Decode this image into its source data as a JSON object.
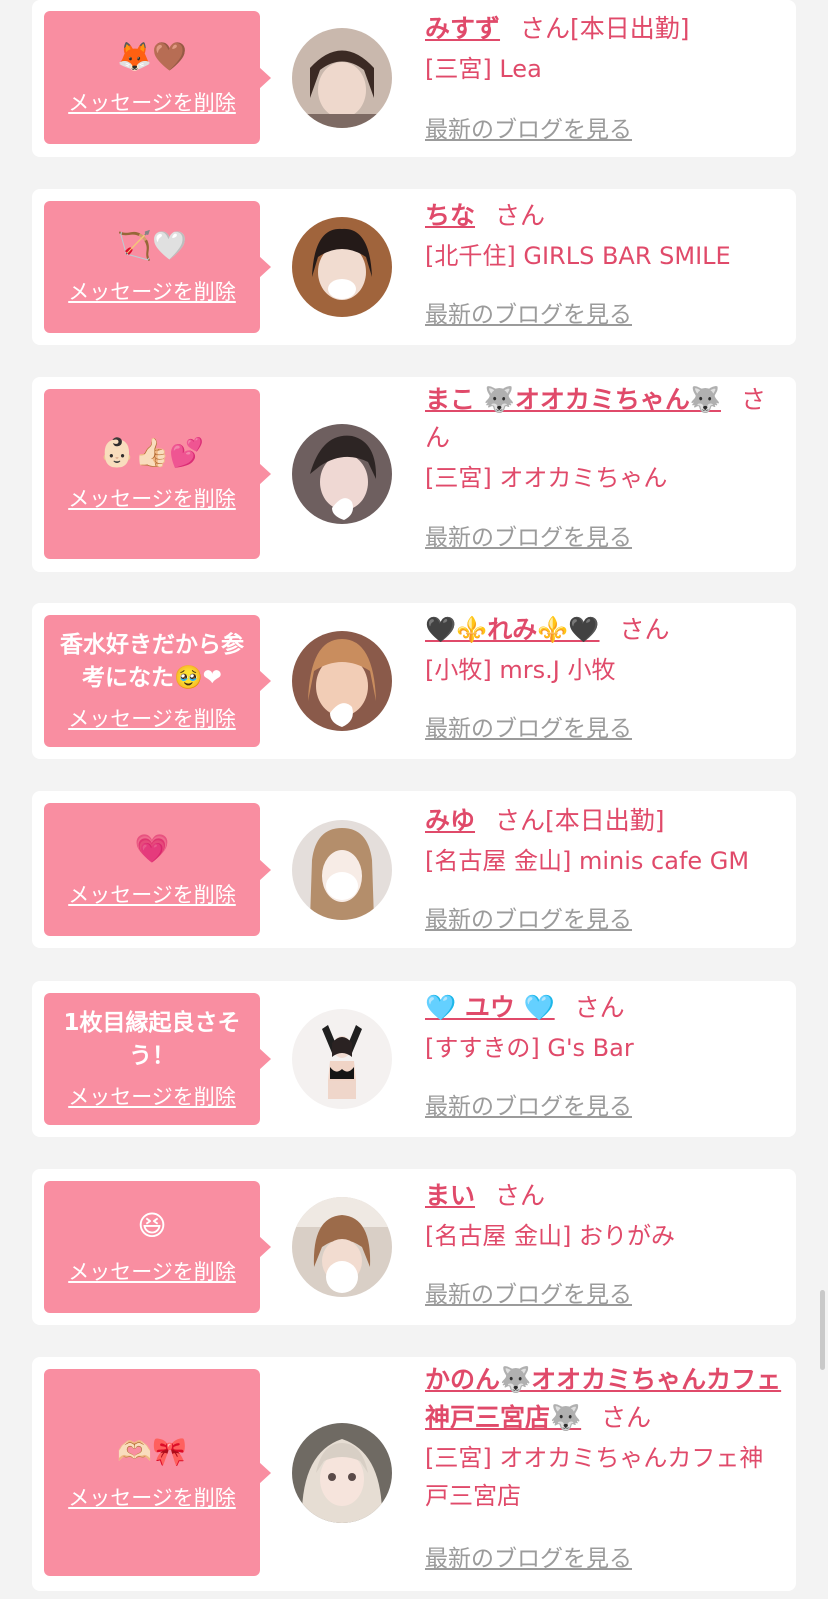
{
  "cards": [
    {
      "message": "🦊🤎",
      "delete_label": "メッセージを削除",
      "name": "みすず",
      "san": "さん[本日出勤]",
      "shop": "[三宮] Lea",
      "blog_label": "最新のブログを見る"
    },
    {
      "message": "🏹🤍",
      "delete_label": "メッセージを削除",
      "name": "ちな",
      "san": "さん",
      "shop": "[北千住] GIRLS BAR SMILE",
      "blog_label": "最新のブログを見る"
    },
    {
      "message": "👶🏻👍🏻💕",
      "delete_label": "メッセージを削除",
      "name": "まこ 🐺オオカミちゃん🐺",
      "san": "さん",
      "shop": "[三宮] オオカミちゃん",
      "blog_label": "最新のブログを見る"
    },
    {
      "message": "香水好きだから参考になた🥹❤︎",
      "delete_label": "メッセージを削除",
      "name": "🖤⚜️れみ⚜️🖤",
      "san": "さん",
      "shop": "[小牧] mrs.J 小牧",
      "blog_label": "最新のブログを見る"
    },
    {
      "message": "💗",
      "delete_label": "メッセージを削除",
      "name": "みゆ",
      "san": "さん[本日出勤]",
      "shop": "[名古屋 金山] minis cafe GM",
      "blog_label": "最新のブログを見る"
    },
    {
      "message": "1枚目縁起良さそう！",
      "delete_label": "メッセージを削除",
      "name": "🩵 ユウ 🩵",
      "san": "さん",
      "shop": "[すすきの] G's Bar",
      "blog_label": "最新のブログを見る"
    },
    {
      "message": "😆",
      "delete_label": "メッセージを削除",
      "name": "まい",
      "san": "さん",
      "shop": "[名古屋 金山] おりがみ",
      "blog_label": "最新のブログを見る"
    },
    {
      "message": "🫶🏻🎀",
      "delete_label": "メッセージを削除",
      "name": "かのん🐺オオカミちゃんカフェ神戸三宮店🐺",
      "san": "さん",
      "shop": "[三宮] オオカミちゃんカフェ神戸三宮店",
      "blog_label": "最新のブログを見る"
    }
  ]
}
